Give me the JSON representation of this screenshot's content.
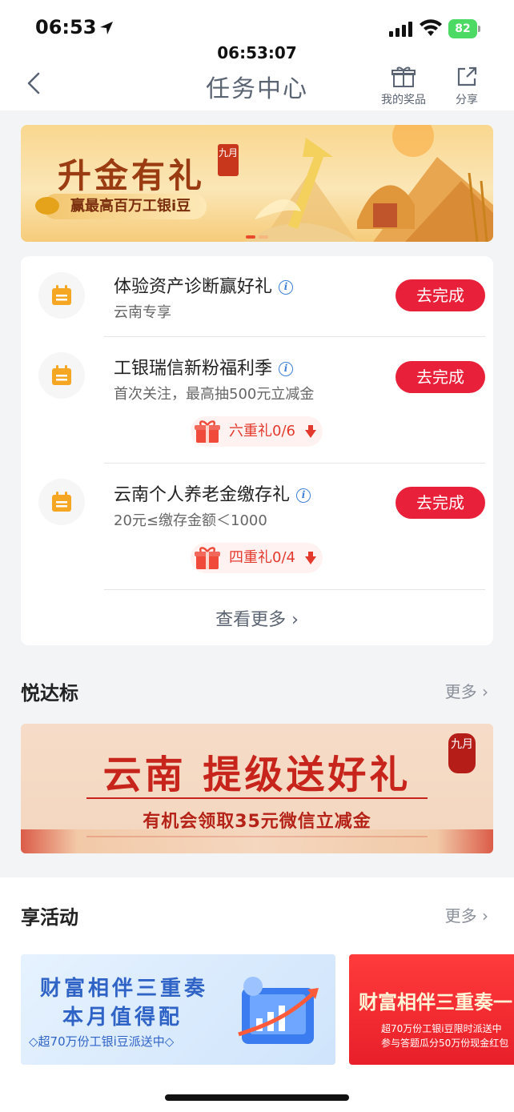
{
  "status_bar": {
    "time": "06:53",
    "battery": "82",
    "clock_overlay": "06:53:07"
  },
  "header": {
    "title": "任务中心",
    "my_prizes": "我的奖品",
    "share": "分享"
  },
  "banner": {
    "title": "升金有礼",
    "seal": "九月",
    "subtitle": "赢最高百万工银i豆"
  },
  "tasks": [
    {
      "title": "体验资产诊断赢好礼",
      "subtitle": "云南专享",
      "button": "去完成",
      "icon": "calendar-icon"
    },
    {
      "title": "工银瑞信新粉福利季",
      "subtitle": "首次关注，最高抽500元立减金",
      "button": "去完成",
      "gift": "六重礼0/6",
      "icon": "calendar-icon"
    },
    {
      "title": "云南个人养老金缴存礼",
      "subtitle": "20元≤缴存金额＜1000",
      "button": "去完成",
      "gift": "四重礼0/4",
      "icon": "calendar-icon"
    }
  ],
  "see_more": "查看更多",
  "section_ydb": {
    "title": "悦达标",
    "more": "更多",
    "banner_title": "云南 提级送好礼",
    "banner_sub": "有机会领取35元微信立减金",
    "banner_seal": "九月"
  },
  "section_act": {
    "title": "享活动",
    "more": "更多",
    "card1_line1": "财富相伴三重奏",
    "card1_line2": "本月值得配",
    "card1_pill": "◇超70万份工银i豆派送中◇",
    "card2_title": "财富相伴三重奏一",
    "card2_line1": "超70万份工银i豆限时派送中",
    "card2_line2": "参与答题瓜分50万份现金红包"
  },
  "colors": {
    "accent_red": "#e8203a",
    "title_gray": "#5b6472",
    "info_blue": "#3e7fd8",
    "calendar_orange": "#f5a623"
  }
}
